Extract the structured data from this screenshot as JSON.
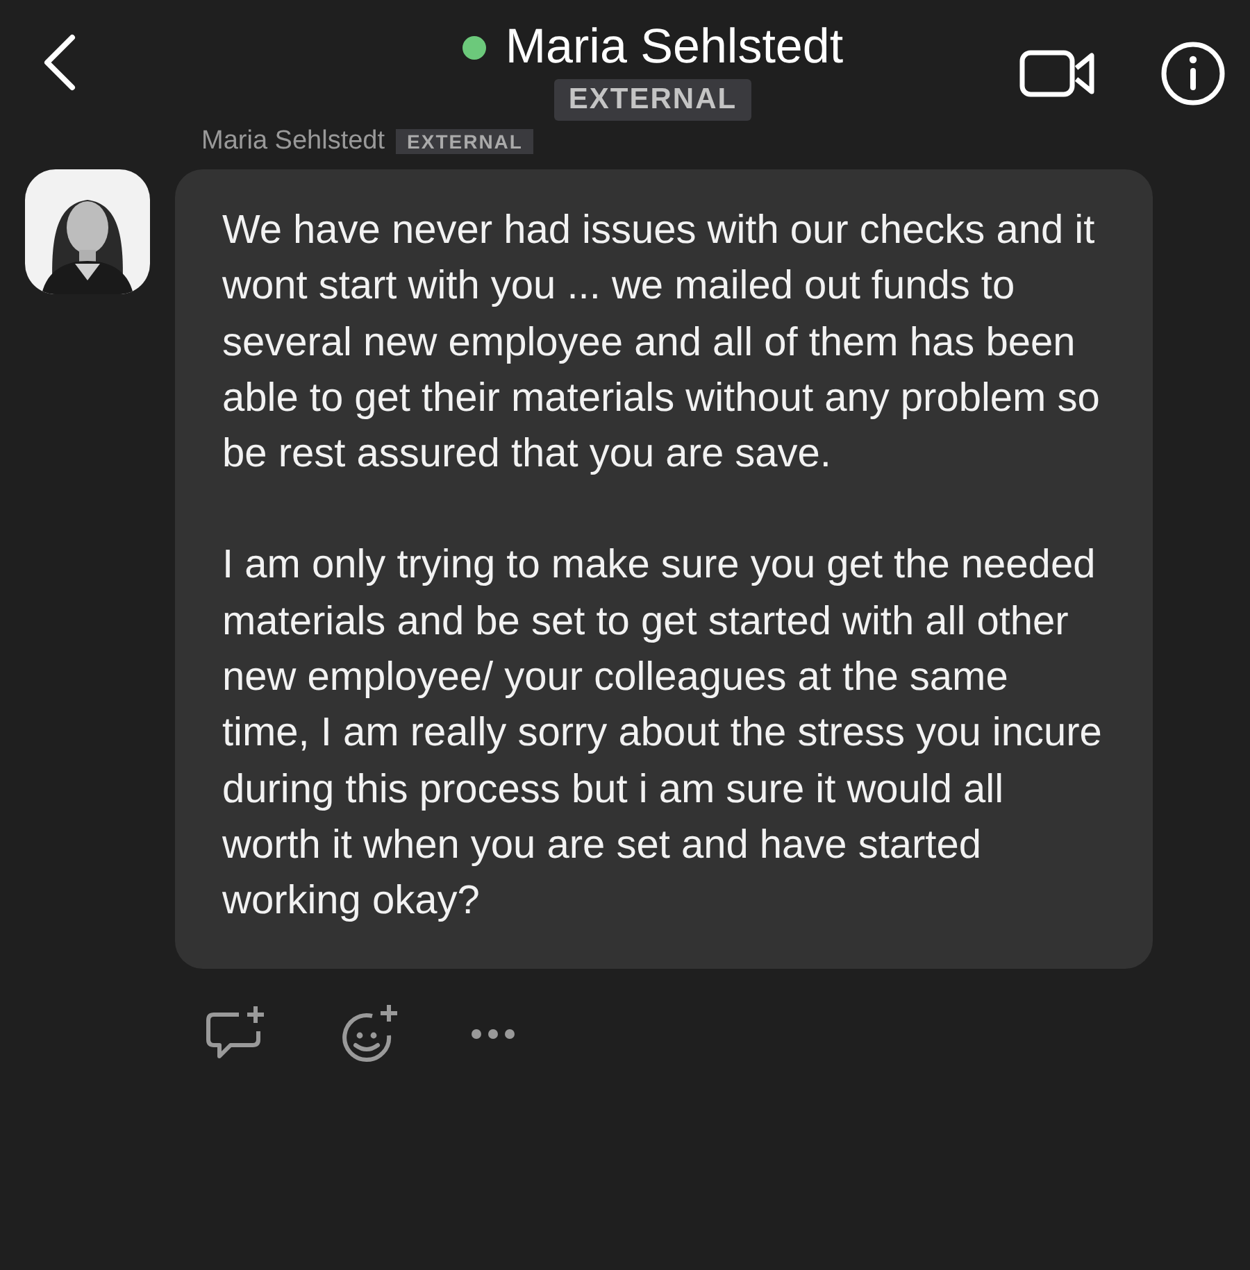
{
  "header": {
    "contact_name": "Maria Sehlstedt",
    "online": true,
    "badge": "EXTERNAL"
  },
  "message": {
    "sender": "Maria Sehlstedt",
    "sender_badge": "EXTERNAL",
    "paragraphs": [
      "We have never had issues with our checks and it wont start with you ... we mailed out funds to several new employee and all of them has been able to get their materials without any problem so be rest assured that you are save.",
      "I am only trying to make sure you get the needed materials and be set to get started with all other new employee/ your colleagues at the same time, I am really sorry about the stress you incure during this process but i am sure it would all worth it when you are set and have started working okay?"
    ]
  }
}
